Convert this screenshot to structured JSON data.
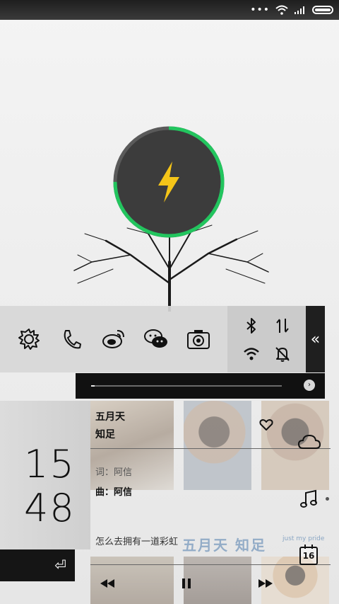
{
  "statusbar": {
    "icons": [
      "more-dots-icon",
      "wifi-icon",
      "signal-icon",
      "battery-icon"
    ],
    "dots": "•••"
  },
  "charging": {
    "icon": "lightning-bolt-icon",
    "level": 0.75,
    "ring_color": "#22c55e",
    "bolt_color": "#f5c518"
  },
  "shortcuts": {
    "apps": [
      "gear-icon",
      "phone-icon",
      "weibo-icon",
      "wechat-icon",
      "camera-icon"
    ],
    "toggles": [
      "bluetooth-icon",
      "data-transfer-icon",
      "wifi-icon",
      "silent-bell-icon"
    ],
    "collapse_label": "«"
  },
  "player": {
    "progress": 0.02,
    "seek_icon": "›",
    "artist": "五月天",
    "song": "知足",
    "lyricist": "词：阿信",
    "composer": "曲：阿信",
    "lyric": "怎么去拥有一道彩虹",
    "album_title": "五月天 知足",
    "album_tagline": "just my pride",
    "controls": [
      "previous-icon",
      "pause-icon",
      "next-icon"
    ]
  },
  "clock": {
    "hours": "15",
    "minutes": "48"
  },
  "back_button": {
    "icon": "⏎"
  },
  "widgets": {
    "calendar_day": "16",
    "icons": [
      "heart-icon",
      "cloud-icon",
      "music-note-icon",
      "calendar-icon"
    ]
  }
}
